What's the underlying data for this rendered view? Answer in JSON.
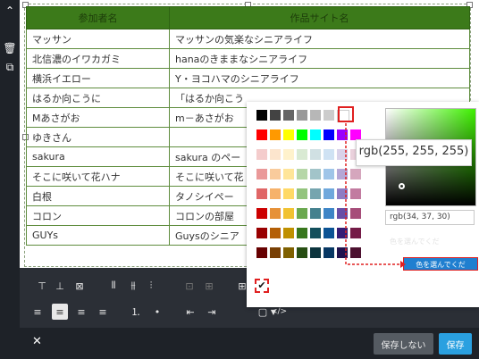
{
  "table": {
    "headers": [
      "参加者名",
      "作品サイト名"
    ],
    "rows": [
      [
        "マッサン",
        "マッサンの気楽なシニアライフ"
      ],
      [
        "北信濃のイワカガミ",
        "hanaのきままなシニアライフ"
      ],
      [
        "横浜イエロー",
        "Y・ヨコハマのシニアライフ"
      ],
      [
        "はるか向こうに",
        "「はるか向こう"
      ],
      [
        "Mあさがお",
        "m－あさがお"
      ],
      [
        "ゆきさん",
        ""
      ],
      [
        "sakura",
        "sakura のペー"
      ],
      [
        "そこに咲いて花ハナ",
        "そこに咲いて花"
      ],
      [
        "白根",
        "タノシイペー"
      ],
      [
        "コロン",
        "コロンの部屋"
      ],
      [
        "GUYs",
        "Guysのシニア"
      ]
    ]
  },
  "picker": {
    "tooltip": "rgb(255, 255, 255)",
    "value": "rgb(34, 37, 30)",
    "hint_faded": "色を選んでくだ",
    "callout": "色を選んでくだ",
    "palette": [
      [
        "#000000",
        "#434343",
        "#666666",
        "#999999",
        "#b7b7b7",
        "#cccccc",
        "#ffffff"
      ],
      [
        "#ff0000",
        "#ff9900",
        "#ffff00",
        "#00ff00",
        "#00ffff",
        "#0000ff",
        "#9900ff",
        "#ff00ff"
      ],
      [
        "#f4cccc",
        "#fce5cd",
        "#fff2cc",
        "#d9ead3",
        "#d0e0e3",
        "#cfe2f3",
        "#d9d2e9",
        "#ead1dc"
      ],
      [
        "#ea9999",
        "#f9cb9c",
        "#ffe599",
        "#b6d7a8",
        "#a2c4c9",
        "#9fc5e8",
        "#b4a7d6",
        "#d5a6bd"
      ],
      [
        "#e06666",
        "#f6b26b",
        "#ffd966",
        "#93c47d",
        "#76a5af",
        "#6fa8dc",
        "#8e7cc3",
        "#c27ba0"
      ],
      [
        "#cc0000",
        "#e69138",
        "#f1c232",
        "#6aa84f",
        "#45818e",
        "#3d85c6",
        "#674ea7",
        "#a64d79"
      ],
      [
        "#990000",
        "#b45f06",
        "#bf9000",
        "#38761d",
        "#134f5c",
        "#0b5394",
        "#351c75",
        "#741b47"
      ],
      [
        "#660000",
        "#783f04",
        "#7f6000",
        "#274e13",
        "#0c343d",
        "#073763",
        "#20124d",
        "#4c1130"
      ]
    ]
  },
  "toolbar": {
    "format_label": "▢",
    "code_label": "</>"
  },
  "footer": {
    "close": "✕",
    "no_save": "保存しない",
    "save": "保存"
  },
  "icons": [
    "trash-icon",
    "copy-icon",
    "collapse-icon",
    "check-icon"
  ]
}
